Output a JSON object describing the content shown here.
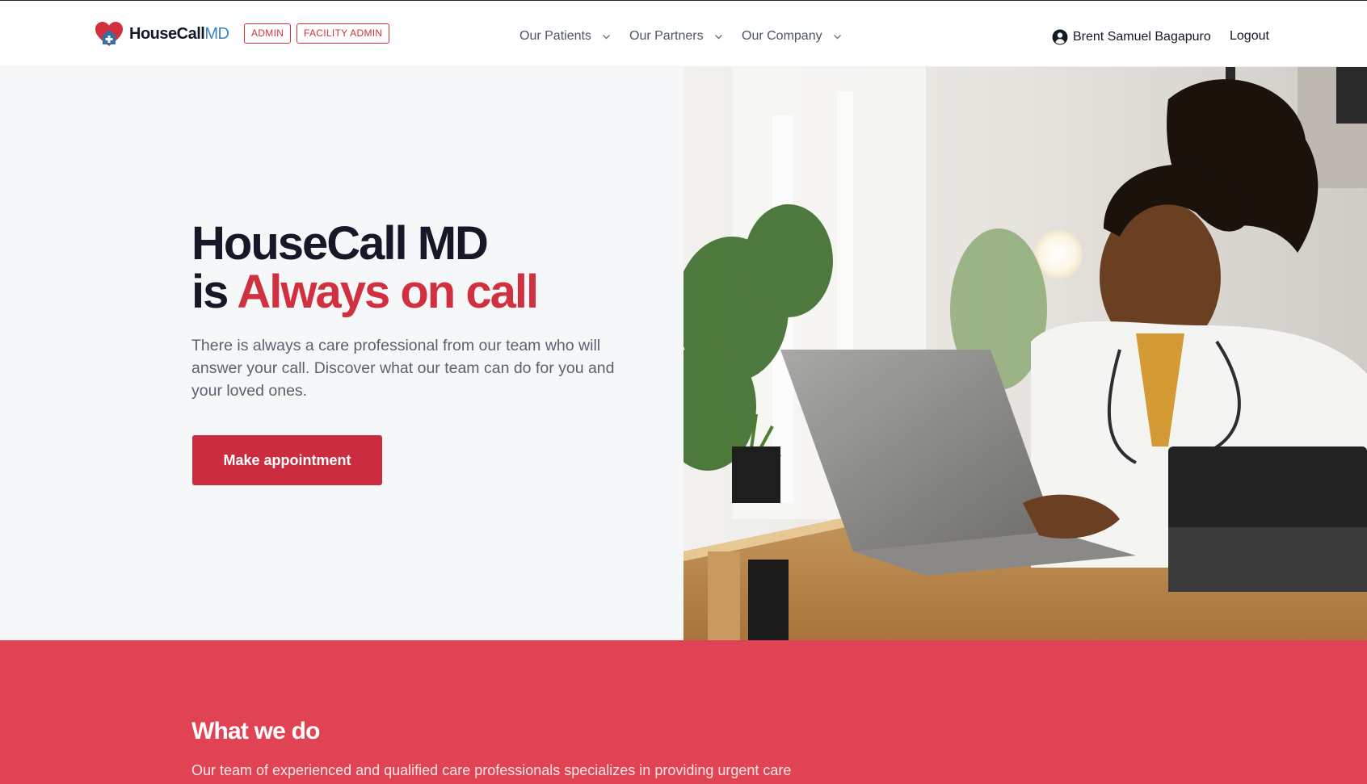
{
  "header": {
    "brand": {
      "name": "HouseCall",
      "suffix": "MD"
    },
    "badges": [
      "ADMIN",
      "FACILITY ADMIN"
    ],
    "nav": [
      {
        "label": "Our Patients",
        "icon": "chevron-down-icon"
      },
      {
        "label": "Our Partners",
        "icon": "chevron-down-icon"
      },
      {
        "label": "Our Company",
        "icon": "chevron-down-icon"
      }
    ],
    "user": {
      "name": "Brent Samuel Bagapuro",
      "icon": "user-circle-icon"
    },
    "logout_label": "Logout"
  },
  "hero": {
    "headline_line1": "HouseCall MD",
    "headline_is": "is",
    "headline_accent": "Always on call",
    "description": "There is always a care professional from our team who will answer your call. Discover what our team can do for you and your loved ones.",
    "cta_label": "Make appointment",
    "image": "doctor-at-laptop-photo"
  },
  "what_we_do": {
    "heading": "What we do",
    "text": "Our team of experienced and qualified care professionals specializes in providing urgent care"
  },
  "colors": {
    "brand_red": "#d1303f",
    "section_red": "#e04454",
    "brand_blue": "#3b82c4",
    "hero_bg": "#f6f7f9"
  }
}
